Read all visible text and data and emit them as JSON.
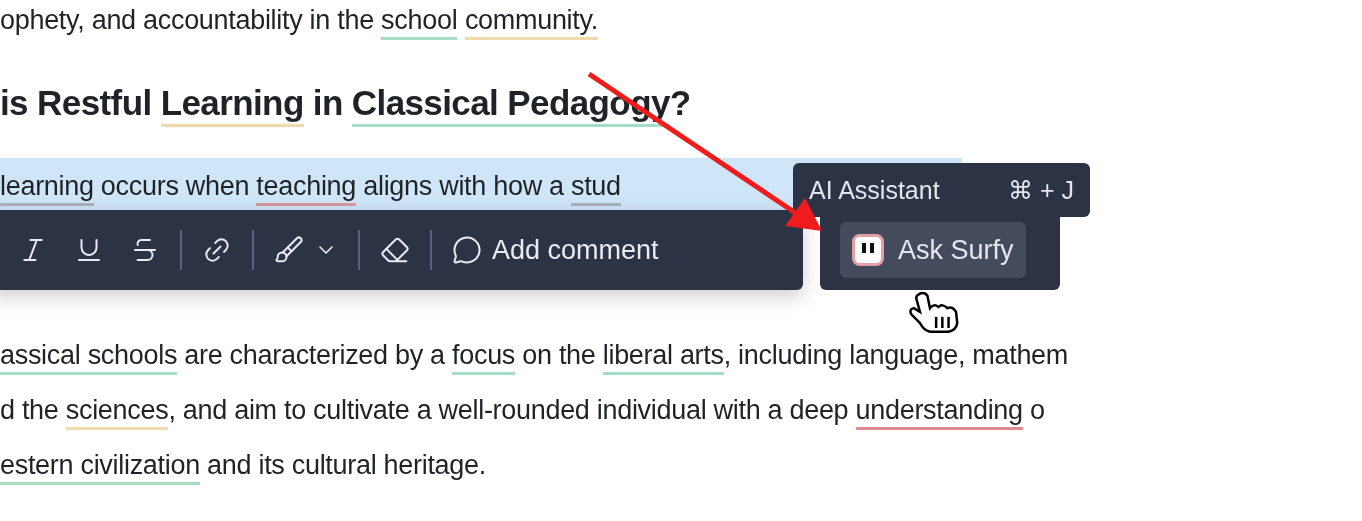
{
  "paragraphs": [
    {
      "kind": "body",
      "segments": [
        {
          "text": "ophety, and accountability in the "
        },
        {
          "text": "school",
          "color": "#a6dcc4"
        },
        {
          "text": "community.",
          "color": "#f0d9ad"
        }
      ]
    },
    {
      "kind": "heading",
      "segments": [
        {
          "text": "is Restful "
        },
        {
          "text": "Learning",
          "color": "#f0d9ad"
        },
        {
          "text": " in "
        },
        {
          "text": "Classical Pedagogy",
          "color": "#a6dcc4"
        },
        {
          "text": "?"
        }
      ]
    },
    {
      "kind": "selected",
      "segments": [
        {
          "text": "learning",
          "color": "#a9b3bb"
        },
        {
          "text": " occurs when "
        },
        {
          "text": "teaching",
          "color": "#d99a9f"
        },
        {
          "text": " aligns with how a "
        },
        {
          "text": "stud",
          "color": "#a9b3bb"
        }
      ]
    }
  ],
  "toolbar": {
    "items": [
      {
        "kind": "italic"
      },
      {
        "kind": "underline"
      },
      {
        "kind": "strikethrough"
      },
      {
        "kind": "divider"
      },
      {
        "kind": "link"
      },
      {
        "kind": "divider"
      },
      {
        "kind": "color"
      },
      {
        "kind": "divider"
      },
      {
        "kind": "eraser"
      },
      {
        "kind": "divider"
      },
      {
        "kind": "comment",
        "label": "Add comment"
      }
    ]
  },
  "ai_menu": {
    "title": "AI Assistant",
    "shortcut": "⌘ + J",
    "button": "Ask Surfy"
  },
  "body": [
    {
      "segments": [
        {
          "text": "assical schools",
          "color": "#a6dcc4"
        },
        {
          "text": " are characterized by a "
        },
        {
          "text": "focus",
          "color": "#a6dcc4"
        },
        {
          "text": " on the "
        },
        {
          "text": "liberal arts",
          "color": "#a6dcc4"
        },
        {
          "text": ", including language, mathem"
        }
      ]
    },
    {
      "segments": [
        {
          "text": "d the "
        },
        {
          "text": "sciences",
          "color": "#f0d9ad"
        },
        {
          "text": ", and aim to cultivate a well-rounded individual with a deep "
        },
        {
          "text": "understanding",
          "color": "#e08a92"
        },
        {
          "text": " o"
        }
      ]
    },
    {
      "segments": [
        {
          "text": "estern civilization",
          "color": "#a6dcc4"
        },
        {
          "text": " and its cultural heritage."
        }
      ]
    }
  ]
}
